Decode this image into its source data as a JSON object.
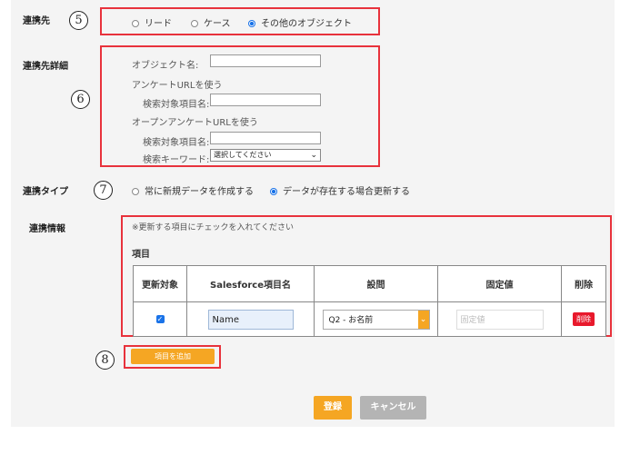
{
  "sections": {
    "target": {
      "label": "連携先",
      "marker": "5",
      "options": [
        "リード",
        "ケース",
        "その他のオブジェクト"
      ],
      "selected_index": 2
    },
    "details": {
      "label": "連携先詳細",
      "marker": "6",
      "object_name_label": "オブジェクト名:",
      "object_name_value": "",
      "survey_url_label": "アンケートURLを使う",
      "search_field_label_1": "検索対象項目名:",
      "search_field_value_1": "",
      "open_survey_url_label": "オープンアンケートURLを使う",
      "search_field_label_2": "検索対象項目名:",
      "search_field_value_2": "",
      "search_keyword_label": "検索キーワード:",
      "search_keyword_selected": "選択してください"
    },
    "type": {
      "label": "連携タイプ",
      "marker": "7",
      "options": [
        "常に新規データを作成する",
        "データが存在する場合更新する"
      ],
      "selected_index": 1
    },
    "info": {
      "label": "連携情報",
      "note": "※更新する項目にチェックを入れてください",
      "items_heading": "項目",
      "columns": [
        "更新対象",
        "Salesforce項目名",
        "設問",
        "固定値",
        "削除"
      ],
      "rows": [
        {
          "checked": true,
          "sf_field": "Name",
          "question": "Q2 - お名前",
          "fixed_placeholder": "固定値",
          "delete_label": "削除"
        }
      ]
    },
    "add": {
      "marker": "8",
      "add_button_label": "項目を追加"
    }
  },
  "footer": {
    "register_label": "登録",
    "cancel_label": "キャンセル"
  },
  "colors": {
    "accent_orange": "#f5a623",
    "highlight_red": "#e8323c",
    "delete_red": "#e8192c",
    "radio_blue": "#1a73e8",
    "cancel_gray": "#b4b4b4"
  }
}
